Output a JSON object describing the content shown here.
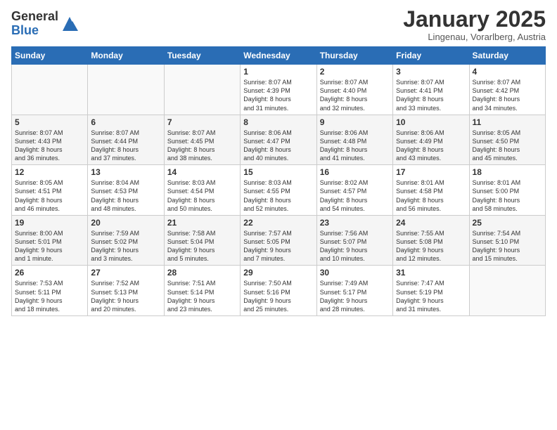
{
  "logo": {
    "general": "General",
    "blue": "Blue"
  },
  "header": {
    "month": "January 2025",
    "location": "Lingenau, Vorarlberg, Austria"
  },
  "weekdays": [
    "Sunday",
    "Monday",
    "Tuesday",
    "Wednesday",
    "Thursday",
    "Friday",
    "Saturday"
  ],
  "weeks": [
    [
      {
        "day": "",
        "info": ""
      },
      {
        "day": "",
        "info": ""
      },
      {
        "day": "",
        "info": ""
      },
      {
        "day": "1",
        "info": "Sunrise: 8:07 AM\nSunset: 4:39 PM\nDaylight: 8 hours\nand 31 minutes."
      },
      {
        "day": "2",
        "info": "Sunrise: 8:07 AM\nSunset: 4:40 PM\nDaylight: 8 hours\nand 32 minutes."
      },
      {
        "day": "3",
        "info": "Sunrise: 8:07 AM\nSunset: 4:41 PM\nDaylight: 8 hours\nand 33 minutes."
      },
      {
        "day": "4",
        "info": "Sunrise: 8:07 AM\nSunset: 4:42 PM\nDaylight: 8 hours\nand 34 minutes."
      }
    ],
    [
      {
        "day": "5",
        "info": "Sunrise: 8:07 AM\nSunset: 4:43 PM\nDaylight: 8 hours\nand 36 minutes."
      },
      {
        "day": "6",
        "info": "Sunrise: 8:07 AM\nSunset: 4:44 PM\nDaylight: 8 hours\nand 37 minutes."
      },
      {
        "day": "7",
        "info": "Sunrise: 8:07 AM\nSunset: 4:45 PM\nDaylight: 8 hours\nand 38 minutes."
      },
      {
        "day": "8",
        "info": "Sunrise: 8:06 AM\nSunset: 4:47 PM\nDaylight: 8 hours\nand 40 minutes."
      },
      {
        "day": "9",
        "info": "Sunrise: 8:06 AM\nSunset: 4:48 PM\nDaylight: 8 hours\nand 41 minutes."
      },
      {
        "day": "10",
        "info": "Sunrise: 8:06 AM\nSunset: 4:49 PM\nDaylight: 8 hours\nand 43 minutes."
      },
      {
        "day": "11",
        "info": "Sunrise: 8:05 AM\nSunset: 4:50 PM\nDaylight: 8 hours\nand 45 minutes."
      }
    ],
    [
      {
        "day": "12",
        "info": "Sunrise: 8:05 AM\nSunset: 4:51 PM\nDaylight: 8 hours\nand 46 minutes."
      },
      {
        "day": "13",
        "info": "Sunrise: 8:04 AM\nSunset: 4:53 PM\nDaylight: 8 hours\nand 48 minutes."
      },
      {
        "day": "14",
        "info": "Sunrise: 8:03 AM\nSunset: 4:54 PM\nDaylight: 8 hours\nand 50 minutes."
      },
      {
        "day": "15",
        "info": "Sunrise: 8:03 AM\nSunset: 4:55 PM\nDaylight: 8 hours\nand 52 minutes."
      },
      {
        "day": "16",
        "info": "Sunrise: 8:02 AM\nSunset: 4:57 PM\nDaylight: 8 hours\nand 54 minutes."
      },
      {
        "day": "17",
        "info": "Sunrise: 8:01 AM\nSunset: 4:58 PM\nDaylight: 8 hours\nand 56 minutes."
      },
      {
        "day": "18",
        "info": "Sunrise: 8:01 AM\nSunset: 5:00 PM\nDaylight: 8 hours\nand 58 minutes."
      }
    ],
    [
      {
        "day": "19",
        "info": "Sunrise: 8:00 AM\nSunset: 5:01 PM\nDaylight: 9 hours\nand 1 minute."
      },
      {
        "day": "20",
        "info": "Sunrise: 7:59 AM\nSunset: 5:02 PM\nDaylight: 9 hours\nand 3 minutes."
      },
      {
        "day": "21",
        "info": "Sunrise: 7:58 AM\nSunset: 5:04 PM\nDaylight: 9 hours\nand 5 minutes."
      },
      {
        "day": "22",
        "info": "Sunrise: 7:57 AM\nSunset: 5:05 PM\nDaylight: 9 hours\nand 7 minutes."
      },
      {
        "day": "23",
        "info": "Sunrise: 7:56 AM\nSunset: 5:07 PM\nDaylight: 9 hours\nand 10 minutes."
      },
      {
        "day": "24",
        "info": "Sunrise: 7:55 AM\nSunset: 5:08 PM\nDaylight: 9 hours\nand 12 minutes."
      },
      {
        "day": "25",
        "info": "Sunrise: 7:54 AM\nSunset: 5:10 PM\nDaylight: 9 hours\nand 15 minutes."
      }
    ],
    [
      {
        "day": "26",
        "info": "Sunrise: 7:53 AM\nSunset: 5:11 PM\nDaylight: 9 hours\nand 18 minutes."
      },
      {
        "day": "27",
        "info": "Sunrise: 7:52 AM\nSunset: 5:13 PM\nDaylight: 9 hours\nand 20 minutes."
      },
      {
        "day": "28",
        "info": "Sunrise: 7:51 AM\nSunset: 5:14 PM\nDaylight: 9 hours\nand 23 minutes."
      },
      {
        "day": "29",
        "info": "Sunrise: 7:50 AM\nSunset: 5:16 PM\nDaylight: 9 hours\nand 25 minutes."
      },
      {
        "day": "30",
        "info": "Sunrise: 7:49 AM\nSunset: 5:17 PM\nDaylight: 9 hours\nand 28 minutes."
      },
      {
        "day": "31",
        "info": "Sunrise: 7:47 AM\nSunset: 5:19 PM\nDaylight: 9 hours\nand 31 minutes."
      },
      {
        "day": "",
        "info": ""
      }
    ]
  ]
}
